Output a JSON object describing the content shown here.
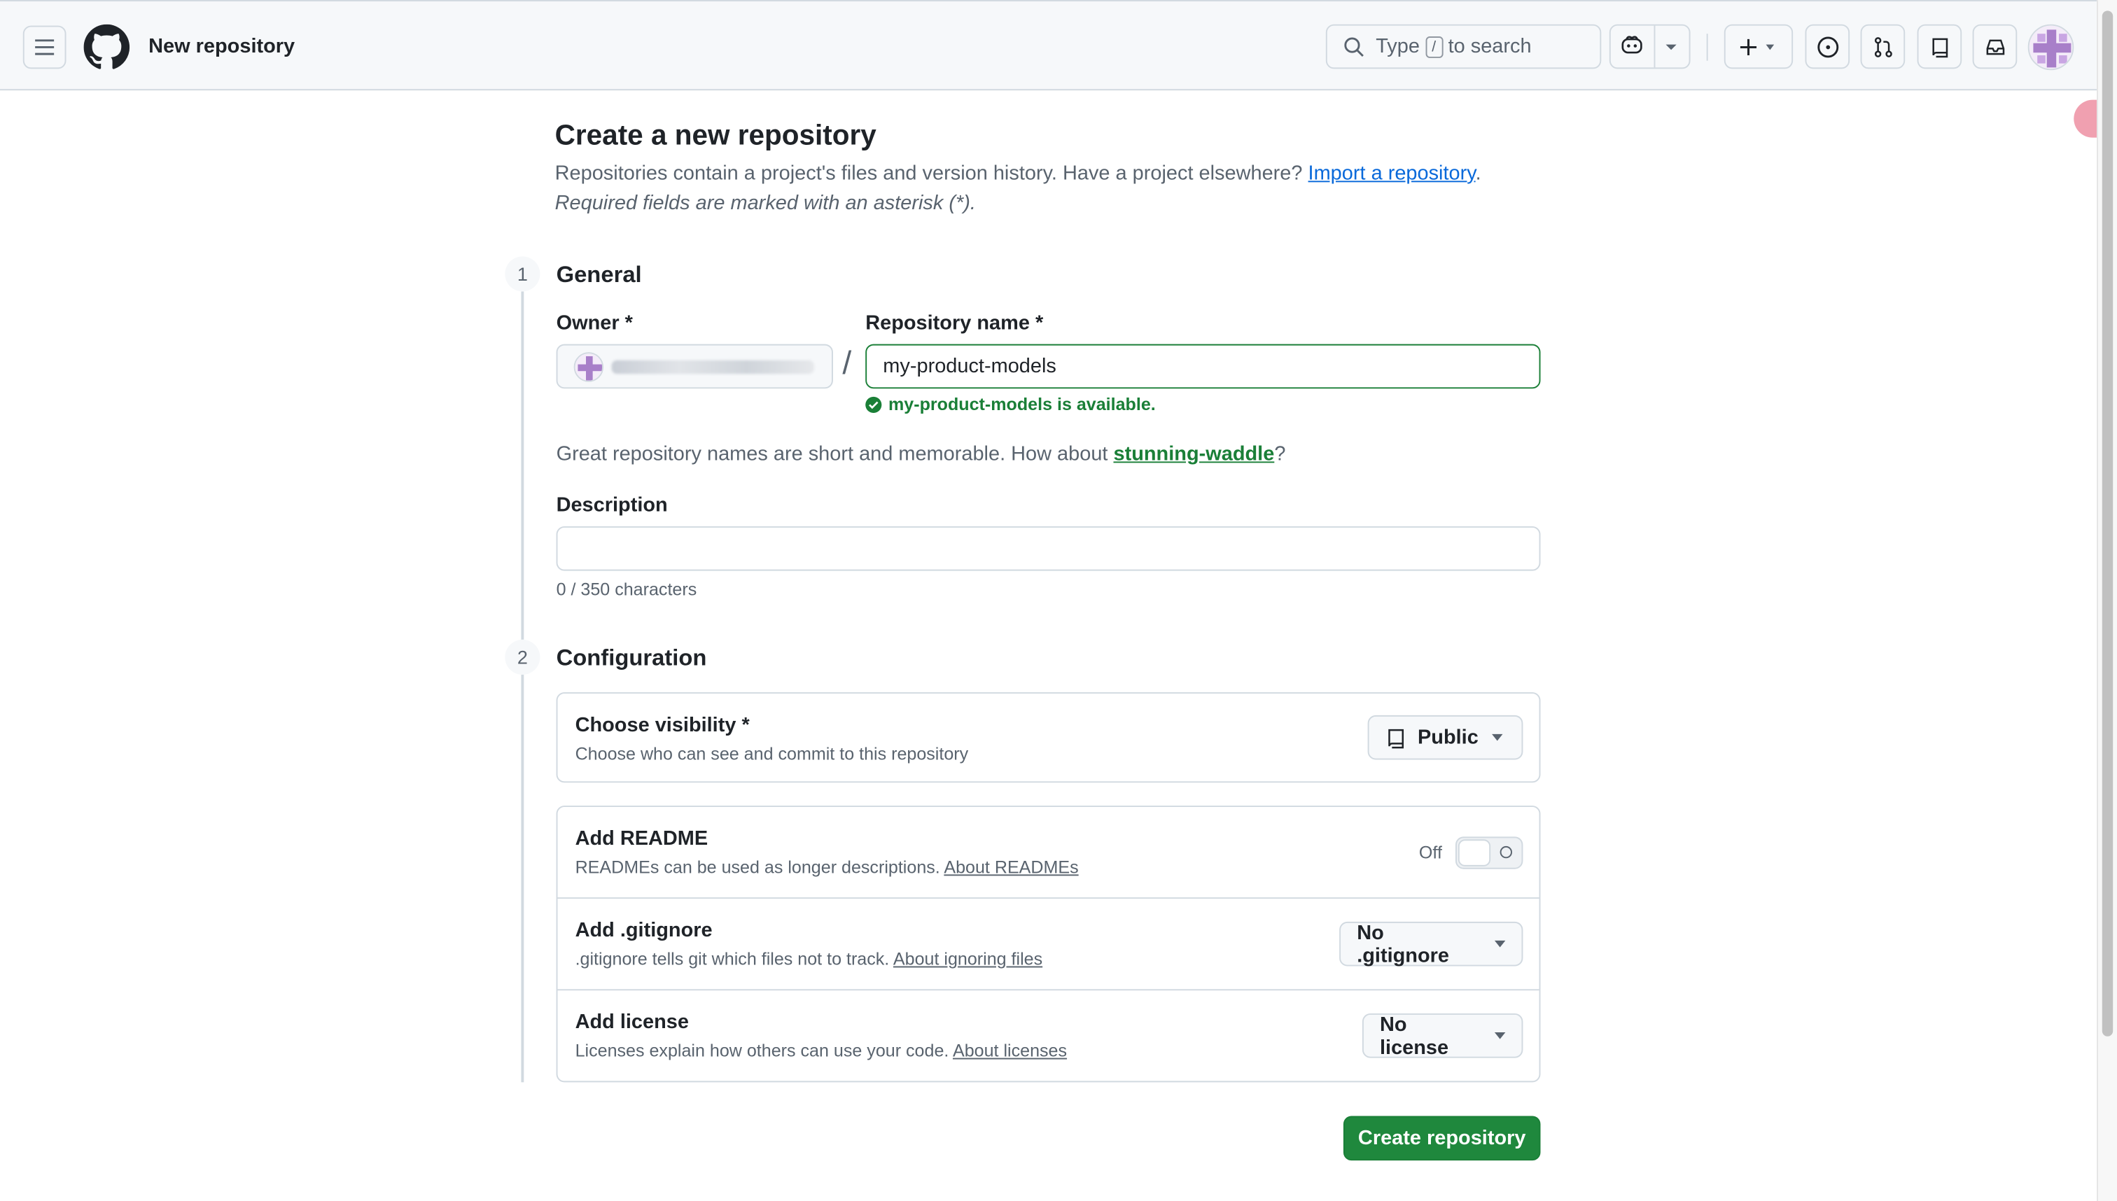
{
  "header": {
    "title": "New repository",
    "search": {
      "before": "Type",
      "key": "/",
      "after": "to search"
    }
  },
  "page": {
    "title": "Create a new repository",
    "intro_text": "Repositories contain a project's files and version history. Have a project elsewhere?",
    "import_link": "Import a repository",
    "intro_end": ".",
    "required_note": "Required fields are marked with an asterisk (*)."
  },
  "general": {
    "step": "1",
    "heading": "General",
    "owner_label": "Owner *",
    "repo_label": "Repository name *",
    "slash": "/",
    "repo_value": "my-product-models",
    "available": "my-product-models is available.",
    "suggest_text": "Great repository names are short and memorable. How about",
    "suggest_name": "stunning-waddle",
    "suggest_end": "?",
    "description_label": "Description",
    "description_value": "",
    "char_count": "0 / 350 characters"
  },
  "configuration": {
    "step": "2",
    "heading": "Configuration",
    "visibility": {
      "title": "Choose visibility *",
      "sub": "Choose who can see and commit to this repository",
      "value": "Public"
    },
    "readme": {
      "title": "Add README",
      "sub": "READMEs can be used as longer descriptions.",
      "link": "About READMEs",
      "state": "Off"
    },
    "gitignore": {
      "title": "Add .gitignore",
      "sub": ".gitignore tells git which files not to track.",
      "link": "About ignoring files",
      "value": "No .gitignore"
    },
    "license": {
      "title": "Add license",
      "sub": "Licenses explain how others can use your code.",
      "link": "About licenses",
      "value": "No license"
    }
  },
  "actions": {
    "create": "Create repository"
  },
  "colors": {
    "accent": "#0969da",
    "success": "#1a7f37",
    "primary_button": "#1f883d"
  }
}
